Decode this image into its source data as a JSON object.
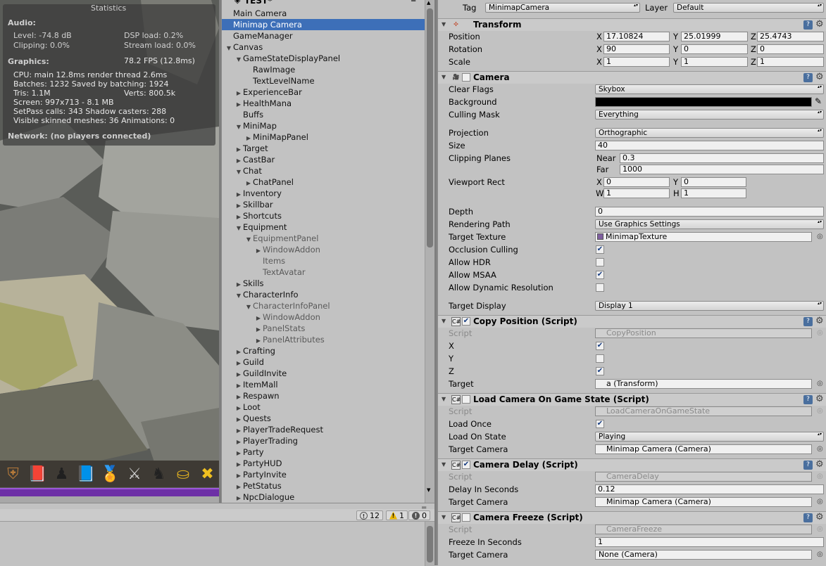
{
  "stats": {
    "title": "Statistics",
    "audio_header": "Audio:",
    "level": "Level: -74.8 dB",
    "clipping": "Clipping: 0.0%",
    "dsp": "DSP load: 0.2%",
    "stream": "Stream load: 0.0%",
    "graphics_header": "Graphics:",
    "fps": "78.2 FPS (12.8ms)",
    "cpu": "CPU: main 12.8ms  render thread 2.6ms",
    "batches": "Batches: 1232    Saved by batching: 1924",
    "tris": "Tris: 1.1M",
    "verts": "Verts: 800.5k",
    "screen": "Screen: 997x713 - 8.1 MB",
    "setpass": "SetPass calls: 343    Shadow casters: 288",
    "skinned": "Visible skinned meshes: 36  Animations: 0",
    "network": "Network: (no players connected)"
  },
  "hotbar": {
    "slots": [
      {
        "icon": "shield-icon",
        "glyph": "⛨",
        "color": "#b67a3a"
      },
      {
        "icon": "spellbook-icon",
        "glyph": "📕",
        "color": "#a02020"
      },
      {
        "icon": "character-icon",
        "glyph": "♟",
        "color": "#202020"
      },
      {
        "icon": "skillbook-icon",
        "glyph": "📘",
        "color": "#2c6ab0"
      },
      {
        "icon": "medal-icon",
        "glyph": "🏅",
        "color": "#4aa8d8"
      },
      {
        "icon": "crossed-swords-icon",
        "glyph": "⚔",
        "color": "#d0d0d0"
      },
      {
        "icon": "horned-helmet-icon",
        "glyph": "♞",
        "color": "#222222"
      },
      {
        "icon": "coins-icon",
        "glyph": "⛀",
        "color": "#e0b020"
      },
      {
        "icon": "close-icon",
        "glyph": "✖",
        "color": "#f0c020"
      }
    ]
  },
  "hierarchy": {
    "scene_name": "TEST*",
    "items": [
      {
        "label": "Main Camera",
        "depth": 1,
        "arrow": ""
      },
      {
        "label": "Minimap Camera",
        "depth": 1,
        "arrow": "",
        "selected": true
      },
      {
        "label": "GameManager",
        "depth": 1,
        "arrow": ""
      },
      {
        "label": "Canvas",
        "depth": 1,
        "arrow": "▼"
      },
      {
        "label": "GameStateDisplayPanel",
        "depth": 2,
        "arrow": "▼"
      },
      {
        "label": "RawImage",
        "depth": 3,
        "arrow": ""
      },
      {
        "label": "TextLevelName",
        "depth": 3,
        "arrow": ""
      },
      {
        "label": "ExperienceBar",
        "depth": 2,
        "arrow": "▶"
      },
      {
        "label": "HealthMana",
        "depth": 2,
        "arrow": "▶"
      },
      {
        "label": "Buffs",
        "depth": 2,
        "arrow": ""
      },
      {
        "label": "MiniMap",
        "depth": 2,
        "arrow": "▼"
      },
      {
        "label": "MiniMapPanel",
        "depth": 3,
        "arrow": "▶"
      },
      {
        "label": "Target",
        "depth": 2,
        "arrow": "▶"
      },
      {
        "label": "CastBar",
        "depth": 2,
        "arrow": "▶"
      },
      {
        "label": "Chat",
        "depth": 2,
        "arrow": "▼"
      },
      {
        "label": "ChatPanel",
        "depth": 3,
        "arrow": "▶"
      },
      {
        "label": "Inventory",
        "depth": 2,
        "arrow": "▶"
      },
      {
        "label": "Skillbar",
        "depth": 2,
        "arrow": "▶"
      },
      {
        "label": "Shortcuts",
        "depth": 2,
        "arrow": "▶"
      },
      {
        "label": "Equipment",
        "depth": 2,
        "arrow": "▼"
      },
      {
        "label": "EquipmentPanel",
        "depth": 3,
        "arrow": "▼",
        "dim": true
      },
      {
        "label": "WindowAddon",
        "depth": 4,
        "arrow": "▶",
        "dim": true
      },
      {
        "label": "Items",
        "depth": 4,
        "arrow": "",
        "dim": true
      },
      {
        "label": "TextAvatar",
        "depth": 4,
        "arrow": "",
        "dim": true
      },
      {
        "label": "Skills",
        "depth": 2,
        "arrow": "▶"
      },
      {
        "label": "CharacterInfo",
        "depth": 2,
        "arrow": "▼"
      },
      {
        "label": "CharacterInfoPanel",
        "depth": 3,
        "arrow": "▼",
        "dim": true
      },
      {
        "label": "WindowAddon",
        "depth": 4,
        "arrow": "▶",
        "dim": true
      },
      {
        "label": "PanelStats",
        "depth": 4,
        "arrow": "▶",
        "dim": true
      },
      {
        "label": "PanelAttributes",
        "depth": 4,
        "arrow": "▶",
        "dim": true
      },
      {
        "label": "Crafting",
        "depth": 2,
        "arrow": "▶"
      },
      {
        "label": "Guild",
        "depth": 2,
        "arrow": "▶"
      },
      {
        "label": "GuildInvite",
        "depth": 2,
        "arrow": "▶"
      },
      {
        "label": "ItemMall",
        "depth": 2,
        "arrow": "▶"
      },
      {
        "label": "Respawn",
        "depth": 2,
        "arrow": "▶"
      },
      {
        "label": "Loot",
        "depth": 2,
        "arrow": "▶"
      },
      {
        "label": "Quests",
        "depth": 2,
        "arrow": "▶"
      },
      {
        "label": "PlayerTradeRequest",
        "depth": 2,
        "arrow": "▶"
      },
      {
        "label": "PlayerTrading",
        "depth": 2,
        "arrow": "▶"
      },
      {
        "label": "Party",
        "depth": 2,
        "arrow": "▶"
      },
      {
        "label": "PartyHUD",
        "depth": 2,
        "arrow": "▶"
      },
      {
        "label": "PartyInvite",
        "depth": 2,
        "arrow": "▶"
      },
      {
        "label": "PetStatus",
        "depth": 2,
        "arrow": "▶"
      },
      {
        "label": "NpcDialogue",
        "depth": 2,
        "arrow": "▶"
      }
    ]
  },
  "console": {
    "log_count": "12",
    "warn_count": "1",
    "error_count": "0"
  },
  "inspector": {
    "tag_label": "Tag",
    "tag_value": "MinimapCamera",
    "layer_label": "Layer",
    "layer_value": "Default",
    "transform": {
      "name": "Transform",
      "position_label": "Position",
      "rotation_label": "Rotation",
      "scale_label": "Scale",
      "pos": {
        "x": "17.10824",
        "y": "25.01999",
        "z": "25.4743"
      },
      "rot": {
        "x": "90",
        "y": "0",
        "z": "0"
      },
      "scale": {
        "x": "1",
        "y": "1",
        "z": "1"
      },
      "x": "X",
      "y": "Y",
      "z": "Z"
    },
    "camera": {
      "name": "Camera",
      "clear_flags_label": "Clear Flags",
      "clear_flags": "Skybox",
      "background_label": "Background",
      "background_color": "#000000",
      "culling_label": "Culling Mask",
      "culling": "Everything",
      "projection_label": "Projection",
      "projection": "Orthographic",
      "size_label": "Size",
      "size": "40",
      "clipping_label": "Clipping Planes",
      "near_label": "Near",
      "near": "0.3",
      "far_label": "Far",
      "far": "1000",
      "viewport_label": "Viewport Rect",
      "vx": "0",
      "vy": "0",
      "vw": "1",
      "vh": "1",
      "w_label": "W",
      "h_label": "H",
      "depth_label": "Depth",
      "depth": "0",
      "rendering_label": "Rendering Path",
      "rendering": "Use Graphics Settings",
      "target_texture_label": "Target Texture",
      "target_texture": "MinimapTexture",
      "occlusion_label": "Occlusion Culling",
      "hdr_label": "Allow HDR",
      "msaa_label": "Allow MSAA",
      "dynres_label": "Allow Dynamic Resolution",
      "target_display_label": "Target Display",
      "target_display": "Display 1"
    },
    "copy_position": {
      "name": "Copy Position (Script)",
      "script_label": "Script",
      "script": "CopyPosition",
      "x_label": "X",
      "y_label": "Y",
      "z_label": "Z",
      "target_label": "Target",
      "target": "a (Transform)"
    },
    "load_camera": {
      "name": "Load Camera On Game State (Script)",
      "script_label": "Script",
      "script": "LoadCameraOnGameState",
      "load_once_label": "Load Once",
      "load_on_state_label": "Load On State",
      "load_on_state": "Playing",
      "target_camera_label": "Target Camera",
      "target_camera": "Minimap Camera (Camera)"
    },
    "camera_delay": {
      "name": "Camera Delay (Script)",
      "script_label": "Script",
      "script": "CameraDelay",
      "delay_label": "Delay In Seconds",
      "delay": "0.12",
      "target_camera_label": "Target Camera",
      "target_camera": "Minimap Camera (Camera)"
    },
    "camera_freeze": {
      "name": "Camera Freeze (Script)",
      "script_label": "Script",
      "script": "CameraFreeze",
      "freeze_label": "Freeze In Seconds",
      "freeze": "1",
      "target_camera_label": "Target Camera",
      "target_camera": "None (Camera)"
    }
  }
}
